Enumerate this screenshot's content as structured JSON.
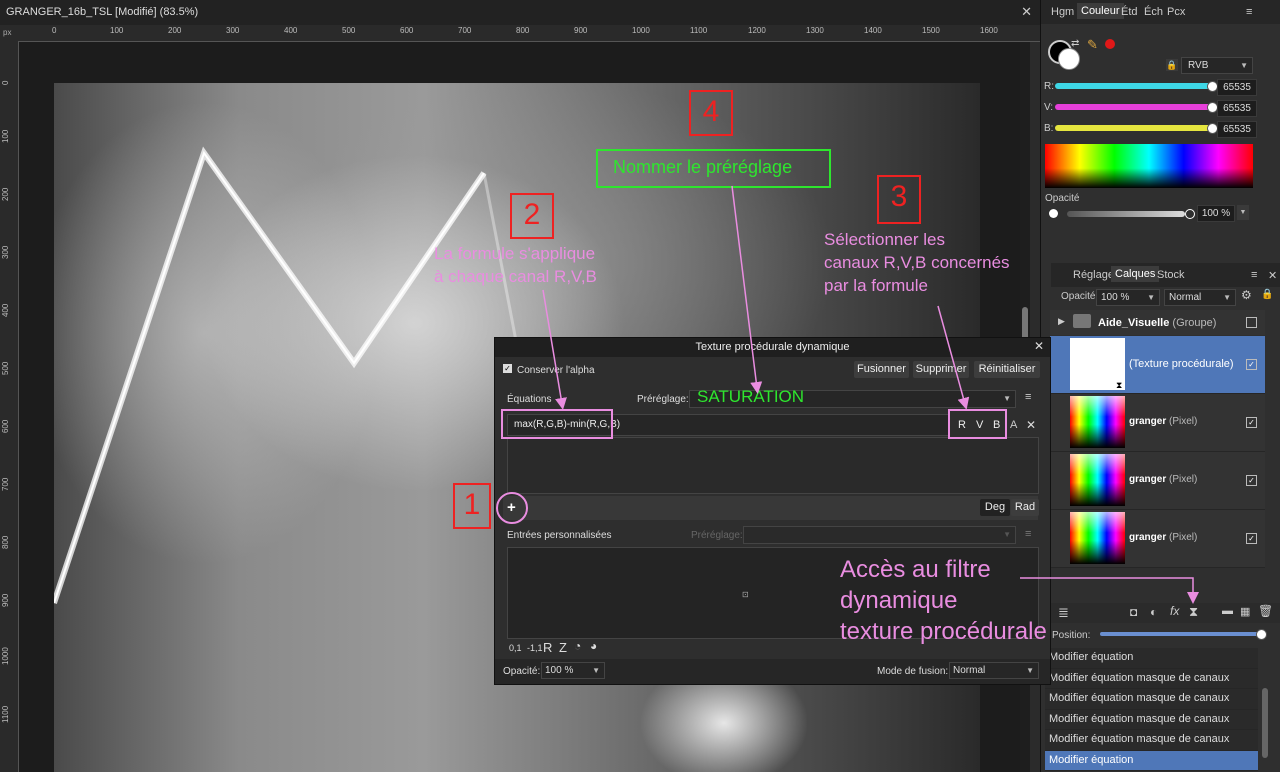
{
  "document": {
    "title": "GRANGER_16b_TSL [Modifié] (83.5%)",
    "ruler_unit": "px",
    "ruler_top_ticks": [
      "0",
      "100",
      "200",
      "300",
      "400",
      "500",
      "600",
      "700",
      "800",
      "900",
      "1000",
      "1100",
      "1200",
      "1300",
      "1400",
      "1500",
      "1600"
    ],
    "ruler_left_ticks": [
      "0",
      "100",
      "200",
      "300",
      "400",
      "500",
      "600",
      "700",
      "800",
      "900",
      "1000",
      "1100"
    ]
  },
  "color_panel": {
    "tabs": [
      "Hgm",
      "Couleur",
      "Étd",
      "Éch",
      "Pcx"
    ],
    "active_tab": "Couleur",
    "model": "RVB",
    "channels": [
      {
        "label": "R:",
        "value": "65535",
        "color": "#3ed7e6"
      },
      {
        "label": "V:",
        "value": "65535",
        "color": "#e63fd9"
      },
      {
        "label": "B:",
        "value": "65535",
        "color": "#e6e63f"
      }
    ],
    "opacity_label": "Opacité",
    "opacity_value": "100 %"
  },
  "layers_panel": {
    "tabs": [
      "Réglage",
      "Calques",
      "Stock"
    ],
    "active_tab": "Calques",
    "opacity_label": "Opacité:",
    "opacity_value": "100 %",
    "blend_mode": "Normal",
    "layers": [
      {
        "name": "Aide_Visuelle",
        "kind": "(Groupe)"
      },
      {
        "name": "",
        "kind": "(Texture procédurale)"
      },
      {
        "name": "granger",
        "kind": "(Pixel)"
      },
      {
        "name": "granger",
        "kind": "(Pixel)"
      },
      {
        "name": "granger",
        "kind": "(Pixel)"
      }
    ],
    "position_label": "Position:"
  },
  "history": {
    "items": [
      "Modifier équation",
      "Modifier équation masque de canaux",
      "Modifier équation masque de canaux",
      "Modifier équation masque de canaux",
      "Modifier équation masque de canaux",
      "Modifier équation"
    ]
  },
  "dialog": {
    "title": "Texture procédurale dynamique",
    "preserve_alpha": "Conserver l'alpha",
    "buttons": {
      "merge": "Fusionner",
      "delete": "Supprimer",
      "reset": "Réinitialiser"
    },
    "equations_label": "Équations",
    "preset_label": "Préréglage:",
    "preset_value": "SATURATION",
    "equation": "max(R,G,B)-min(R,G,B)",
    "channels": [
      "R",
      "V",
      "B",
      "A"
    ],
    "add_symbol": "+",
    "angle_units": [
      "Deg",
      "Rad"
    ],
    "custom_inputs_label": "Entrées personnalisées",
    "custom_preset_label": "Préréglage:",
    "bottom_tools": [
      "0,1",
      "-1,1",
      "R",
      "Z"
    ],
    "opacity_label": "Opacité:",
    "opacity_value": "100 %",
    "blend_label": "Mode de fusion:",
    "blend_value": "Normal"
  },
  "annotations": {
    "n1": "1",
    "n2": "2",
    "n3": "3",
    "n4": "4",
    "preset_name_hint": "Nommer le préréglage",
    "formula_hint_1": "La formule s'applique",
    "formula_hint_2": "à chaque canal R,V,B",
    "channels_hint_1": "Sélectionner les",
    "channels_hint_2": "canaux R,V,B concernés",
    "channels_hint_3": "par la formule",
    "filter_hint_1": "Accès au filtre",
    "filter_hint_2": "dynamique",
    "filter_hint_3": "texture procédurale"
  }
}
